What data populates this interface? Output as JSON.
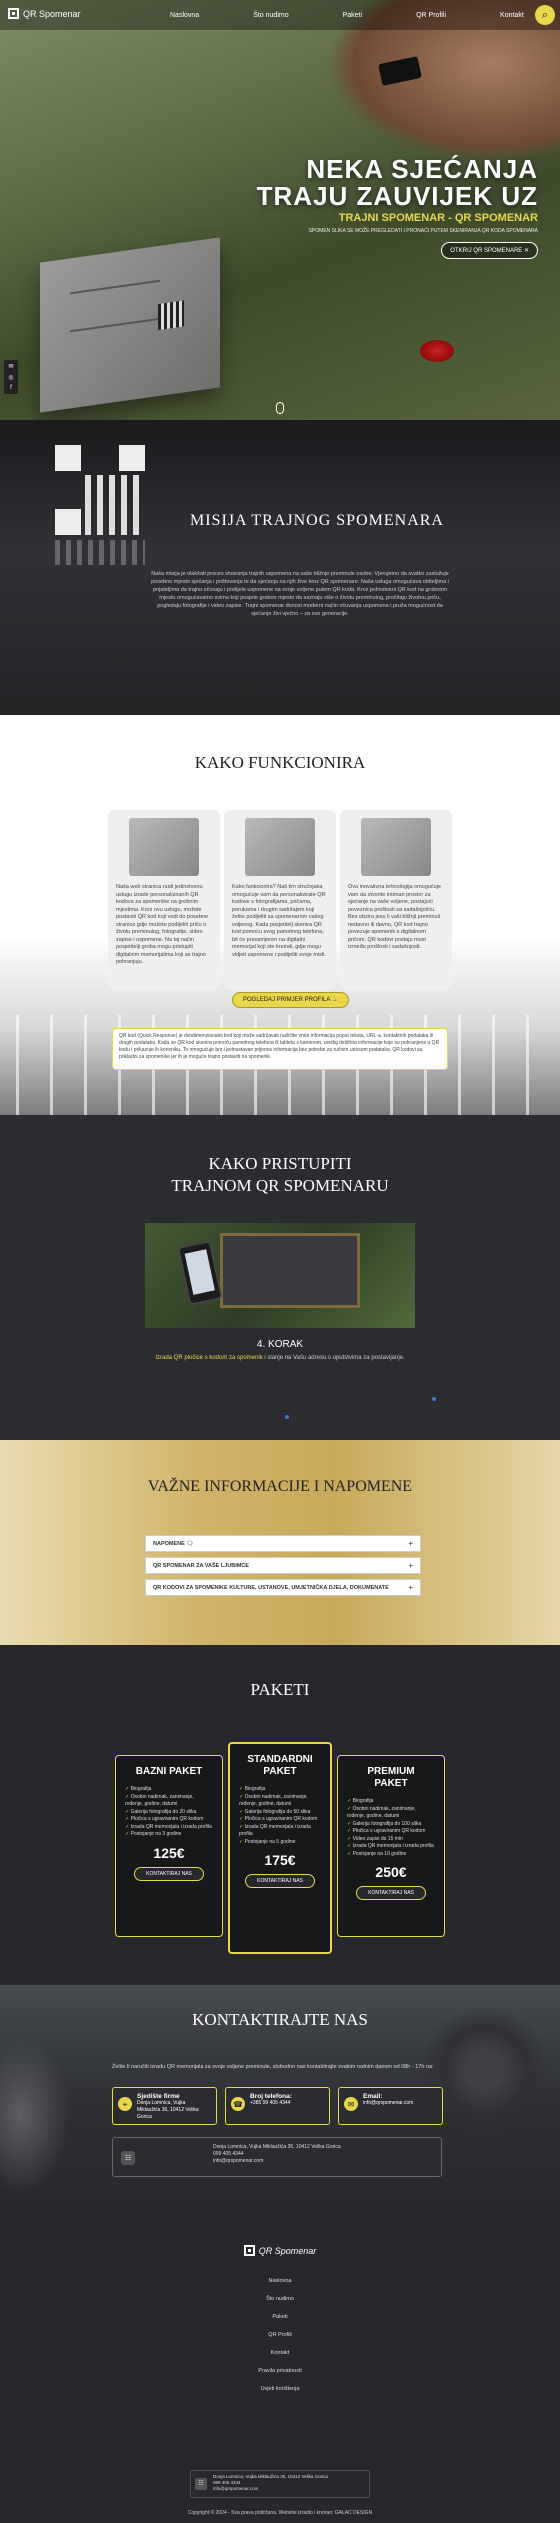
{
  "nav": {
    "logo_text": "QR Spomenar",
    "menu": [
      "Naslovna",
      "Što nudimo",
      "Paketi",
      "QR Profili",
      "Kontakt"
    ]
  },
  "hero": {
    "title_line1": "NEKA SJEĆANJA",
    "title_line2": "TRAJU ZAUVIJEK UZ",
    "subtitle": "TRAJNI SPOMENAR - QR SPOMENAR",
    "small_text": "SPOMEN SLIKA SE MOŽE PREGLEDATI I PRONAĆI PUTEM SKENIRANJA QR KODA SPOMENARA",
    "cta": "OTKRIJ QR SPOMENARE",
    "cta_icon": "x-icon"
  },
  "misija": {
    "title": "MISIJA TRAJNOG SPOMENARA",
    "text": "Naša misija je olakšati proces stvaranja trajnih uspomena na vaše bližnje preminule osobe. Vjerujemo da svatko zaslužuje posebno mjesto sjećanja i poštovanja te da sjećanja na njih žive kroz QR spomenare. Naša usluga omogućava obiteljima i prijateljima da trajno očuvaju i podijele uspomene na svoje voljene putem QR koda. Kroz jedinstveni QR kod na grobnom mjestu omogućavamo svima koji posjete grobno mjesto da saznaju više o životu preminulog, pročitaju životnu priču, pogledaju fotografije i video zapise. Trajni spomenar donosi moderni način očuvanja uspomena i pruža mogućnost da sjećanje živi vječno – za sve generacije."
  },
  "kako": {
    "title": "KAKO FUNKCIONIRA",
    "cards": [
      "Naša web stranica nudi jedinstvenu uslugu izrade personaliziranih QR kodova za spomenike na grobnim mjestima. Kroz ovu uslugu, možete postaviti QR kod koji vodi do posebne stranice gdje možete podijeliti priču o životu preminulog, fotografije, video zapise i uspomene. Na taj način posjetitelji groba mogu pristupiti digitalnim memorijalima koji se trajno pohranjuju.",
      "Kako funkcionira? Naš tim stručnjaka omogućuje vam da personalizirate QR kodove s fotografijama, pričama, porukama i drugim sadržajem koji želite podijeliti sa spomenarom vašeg voljenog. Kada posjetitelj skenira QR kod pomoću svog pametnog telefona, bit će preusmjeren na digitalni memorijal koji ste kreirali, gdje mogu vidjeti uspomene i podijeliti svoje misli.",
      "Ova inovativna tehnologija omogućuje vam da stvorite intiman prostor za sjećanje na vaše voljene, postajući poveznica prošlosti sa sadašnjošću. Bez obzira jesu li vaši bližnji preminuli nedavno ili davno, QR kod trajno povezuje spomenik s digitalnom pričom. QR kodovi postaju most između prošlosti i sadašnjosti."
    ],
    "button": "POGLEDAJ PRIMJER PROFILA",
    "note": "QR kod (Quick Response) je dvodimenzionalni kod koji može sadržavati različite vrste informacija poput teksta, URL-a, kontaktnih podataka ili drugih podataka. Kada se QR kod skenira pomoću pametnog telefona ili tableta s kamerom, uređaj dešifrira informacije koje su pohranjene u QR kodu i prikazuje ih korisniku. To omogućuje brz i jednostavan prijenos informacija bez potrebe za ručnim unosom podataka. QR kodovi su prikladni za spomenike jer ih je moguće trajno postaviti na spomenik."
  },
  "pristup": {
    "title_line1": "KAKO PRISTUPITI",
    "title_line2": "TRAJNOM QR SPOMENARU",
    "step": "4. KORAK",
    "desc_highlight": "Izrada QR pločice s kodom za spomenik",
    "desc_rest": " i slanje na Vašu adresu s uputstvima za postavljanje."
  },
  "vazne": {
    "title": "VAŽNE INFORMACIJE I NAPOMENE",
    "items": [
      "NAPOMENE",
      "QR SPOMENAR ZA VAŠE LJUBIMCE",
      "QR KODOVI ZA SPOMENIKE KULTURE, USTANOVE, UMJETNIČKA DJELA, DOKUMENATE"
    ]
  },
  "paketi": {
    "title": "PAKETI",
    "plans": [
      {
        "name_l1": "BAZNI",
        "name_l2": "PAKET",
        "price": "125€",
        "button": "KONTAKTIRAJ NAS",
        "features": [
          "Biografija",
          "Osobni nadimak, zanimanje, rođenje, godine, datumi",
          "Galerija fotografija do 20 slika",
          "Pločica s ugraviranim QR kodom",
          "Izrada QR memorijala i izrada profila",
          "Postojanje na 3 godine"
        ]
      },
      {
        "name_l1": "STANDARDNI",
        "name_l2": "PAKET",
        "price": "175€",
        "button": "KONTAKTIRAJ NAS",
        "features": [
          "Biografija",
          "Osobni nadimak, zanimanje, rođenje, godine, datumi",
          "Galerija fotografija do 50 slika",
          "Pločica s ugraviranim QR kodom",
          "Izrada QR memorijala i izrada profila",
          "Postojanje na 5 godine"
        ]
      },
      {
        "name_l1": "PREMIUM",
        "name_l2": "PAKET",
        "price": "250€",
        "button": "KONTAKTIRAJ NAS",
        "features": [
          "Biografija",
          "Osobni nadimak, zanimanje, rođenje, godine, datumi",
          "Galerija fotografija do 100 slika",
          "Pločica s ugraviranim QR kodom",
          "Video zapisi do 15 min",
          "Izrada QR memorijala i izrada profila",
          "Postojanje na 10 godine"
        ]
      }
    ]
  },
  "kontakt": {
    "title": "KONTAKTIRAJTE NAS",
    "intro": "Želite li naručiti izradu QR memorijala za svoje voljene preminule, slobodno nas kontaktirajte svakim radnim danom od 08h - 17h na:",
    "boxes": [
      {
        "title": "Sjedište firme",
        "lines": [
          "Donja Lomnica, Vujka",
          "Miklaužića 36, 10412 Velika",
          "Gorica"
        ],
        "icon": "map-icon"
      },
      {
        "title": "Broj telefona:",
        "lines": [
          "+385 99 405 4344"
        ],
        "icon": "phone-icon"
      },
      {
        "title": "Email:",
        "lines": [
          "info@qrspomenar.com"
        ],
        "icon": "email-icon"
      }
    ],
    "address_lines": [
      "Donja Lomnica, Vujka Miklaužića 36, 10412 Velika Gorica",
      "099 405 4344",
      "info@qrspomenar.com"
    ]
  },
  "footer": {
    "logo_text": "QR Spomenar",
    "links": [
      "Naslovna",
      "Što nudimo",
      "Paketi",
      "QR Profili",
      "Kontakt",
      "Pravila privatnosti",
      "Uvjeti korištenja"
    ],
    "address_lines": [
      "Donja Lomnica, Vujka Miklaužića 36, 10412 Velika Gorica",
      "099 405 4344",
      "info@qrspomenar.com"
    ],
    "copyright": "Copyright © 2024 - Sva prava pridržana. Website izradio i kreirao: GALAC DESIGN"
  },
  "colors": {
    "accent": "#e7d74a",
    "dark": "#24272c"
  }
}
